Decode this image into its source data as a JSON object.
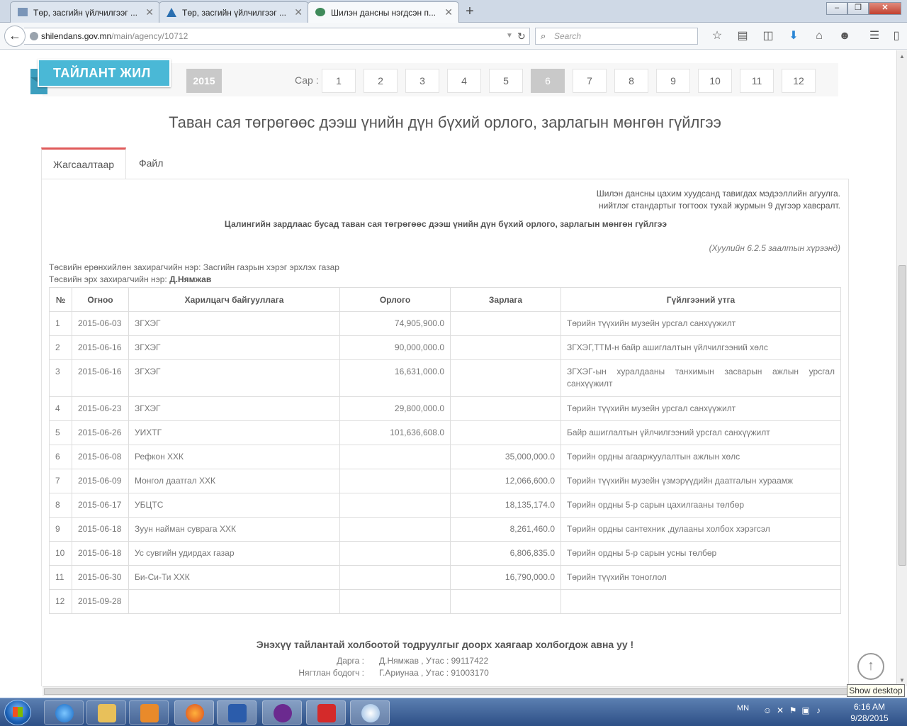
{
  "browser": {
    "tabs": [
      {
        "label": "Төр, засгийн үйлчилгээг ...",
        "close": "✕"
      },
      {
        "label": "Төр, засгийн үйлчилгээг ...",
        "close": "✕"
      },
      {
        "label": "Шилэн дансны нэгдсэн п...",
        "close": "✕"
      }
    ],
    "new_tab": "+",
    "window_buttons": {
      "minimize": "‒",
      "maximize": "❐",
      "close": "✕"
    },
    "url_host": "shilendans.gov.mn",
    "url_path": "/main/agency/10712",
    "search_placeholder": "Search"
  },
  "header": {
    "ribbon": "ТАЙЛАНТ ЖИЛ",
    "year": "2015",
    "month_label": "Сар :",
    "months": [
      "1",
      "2",
      "3",
      "4",
      "5",
      "6",
      "7",
      "8",
      "9",
      "10",
      "11",
      "12"
    ],
    "active_month": "6"
  },
  "title": "Таван сая төгрөгөөс дээш үнийн дүн бүхий орлого, зарлагын мөнгөн гүйлгээ",
  "tabs": [
    "Жагсаалтаар",
    "Файл"
  ],
  "panel": {
    "note_line1": "Шилэн дансны цахим хуудсанд тавигдах мэдээллийн агуулга.",
    "note_line2": "нийтлэг стандартыг тогтоох тухай журмын 9 дүгээр хавсралт.",
    "subtitle": "Цалингийн зардлаас бусад таван сая төгрөгөөс дээш үнийн дүн бүхий орлого, зарлагын мөнгөн гүйлгээ",
    "law_note": "(Хуулийн 6.2.5 заалтын хүрээнд)",
    "manager_label": "Төсвийн ерөнхийлөн захирагчийн нэр:",
    "manager_value": "Засгийн газрын хэрэг эрхлэх газар",
    "director_label": "Төсвийн эрх захирагчийн нэр:",
    "director_value": "Д.Нямжав"
  },
  "table": {
    "headers": [
      "№",
      "Огноо",
      "Харилцагч байгууллага",
      "Орлого",
      "Зарлага",
      "Гүйлгээний утга"
    ],
    "rows": [
      [
        "1",
        "2015-06-03",
        "ЗГХЭГ",
        "74,905,900.0",
        "",
        "Төрийн түүхийн музейн урсгал санхүүжилт"
      ],
      [
        "2",
        "2015-06-16",
        "ЗГХЭГ",
        "90,000,000.0",
        "",
        "ЗГХЭГ,ТТМ-н байр ашиглалтын үйлчилгээний хөлс"
      ],
      [
        "3",
        "2015-06-16",
        "ЗГХЭГ",
        "16,631,000.0",
        "",
        "ЗГХЭГ-ын хуралдааны танхимын засварын ажлын урсгал санхүүжилт"
      ],
      [
        "4",
        "2015-06-23",
        "ЗГХЭГ",
        "29,800,000.0",
        "",
        "Төрийн түүхийн музейн урсгал санхүүжилт"
      ],
      [
        "5",
        "2015-06-26",
        "УИХТГ",
        "101,636,608.0",
        "",
        "Байр ашиглалтын үйлчилгээний урсгал санхүүжилт"
      ],
      [
        "6",
        "2015-06-08",
        "Рефкон ХХК",
        "",
        "35,000,000.0",
        "Төрийн ордны агааржуулалтын ажлын хөлс"
      ],
      [
        "7",
        "2015-06-09",
        "Монгол даатгал ХХК",
        "",
        "12,066,600.0",
        "Төрийн түүхийн музейн үзмэрүүдийн даатгалын хураамж"
      ],
      [
        "8",
        "2015-06-17",
        "УБЦТС",
        "",
        "18,135,174.0",
        "Төрийн ордны 5-р сарын цахилгааны төлбөр"
      ],
      [
        "9",
        "2015-06-18",
        "Зуун найман суврага ХХК",
        "",
        "8,261,460.0",
        "Төрийн ордны сантехник ,дулааны холбох хэрэгсэл"
      ],
      [
        "10",
        "2015-06-18",
        "Ус сувгийн удирдах газар",
        "",
        "6,806,835.0",
        "Төрийн ордны 5-р сарын усны төлбөр"
      ],
      [
        "11",
        "2015-06-30",
        "Би-Си-Ти ХХК",
        "",
        "16,790,000.0",
        "Төрийн түүхийн тоноглол"
      ],
      [
        "12",
        "2015-09-28",
        "",
        "",
        "",
        ""
      ]
    ]
  },
  "contact": {
    "title": "Энэхүү тайлантай холбоотой тодруулгыг доорх хаягаар холбогдож авна уу !",
    "rows": [
      {
        "role": "Дарга :",
        "info": "Д.Нямжав , Утас : 99117422"
      },
      {
        "role": "Нягтлан бодогч :",
        "info": "Г.Ариунаа , Утас : 91003170"
      }
    ]
  },
  "taskbar": {
    "lang": "MN",
    "time": "6:16 AM",
    "date": "9/28/2015",
    "tooltip": "Show desktop"
  }
}
